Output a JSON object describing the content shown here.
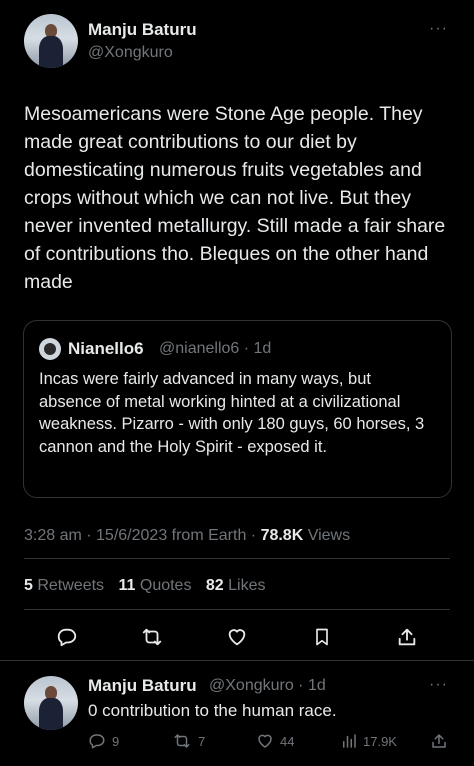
{
  "main_tweet": {
    "author_name": "Manju Baturu",
    "author_handle": "@Xongkuro",
    "more": "···",
    "text": "Mesoamericans were Stone Age people. They made great contributions to our diet by domesticating numerous fruits vegetables and crops without which we can not live. But they never invented metallurgy. Still made a fair share of contributions tho. Bleques on the other hand made",
    "quote": {
      "author_name": "Nianello6",
      "meta": "@nianello6 · 1d",
      "text": "Incas were fairly advanced in many ways, but absence of metal working hinted at a civilizational weakness. Pizarro - with only 180 guys, 60 horses, 3 cannon and the Holy Spirit - exposed it."
    },
    "timestamp": "3:28 am · 15/6/2023 from Earth · ",
    "views_count": "78.8K",
    "views_label": " Views",
    "stats": {
      "retweets_count": "5",
      "retweets_label": " Retweets",
      "quotes_count": "11",
      "quotes_label": " Quotes",
      "likes_count": "82",
      "likes_label": " Likes"
    },
    "actions": [
      "reply-icon",
      "retweet-icon",
      "like-icon",
      "bookmark-icon",
      "share-icon"
    ]
  },
  "reply": {
    "author_name": "Manju Baturu",
    "meta": "@Xongkuro · 1d",
    "more": "···",
    "text": "0 contribution to the human race.",
    "reply_count": "9",
    "retweet_count": "7",
    "like_count": "44",
    "view_count": "17.9K"
  },
  "colors": {
    "background": "#000000",
    "text": "#e7e9ea",
    "muted": "#71767b",
    "border": "#2f3336"
  }
}
